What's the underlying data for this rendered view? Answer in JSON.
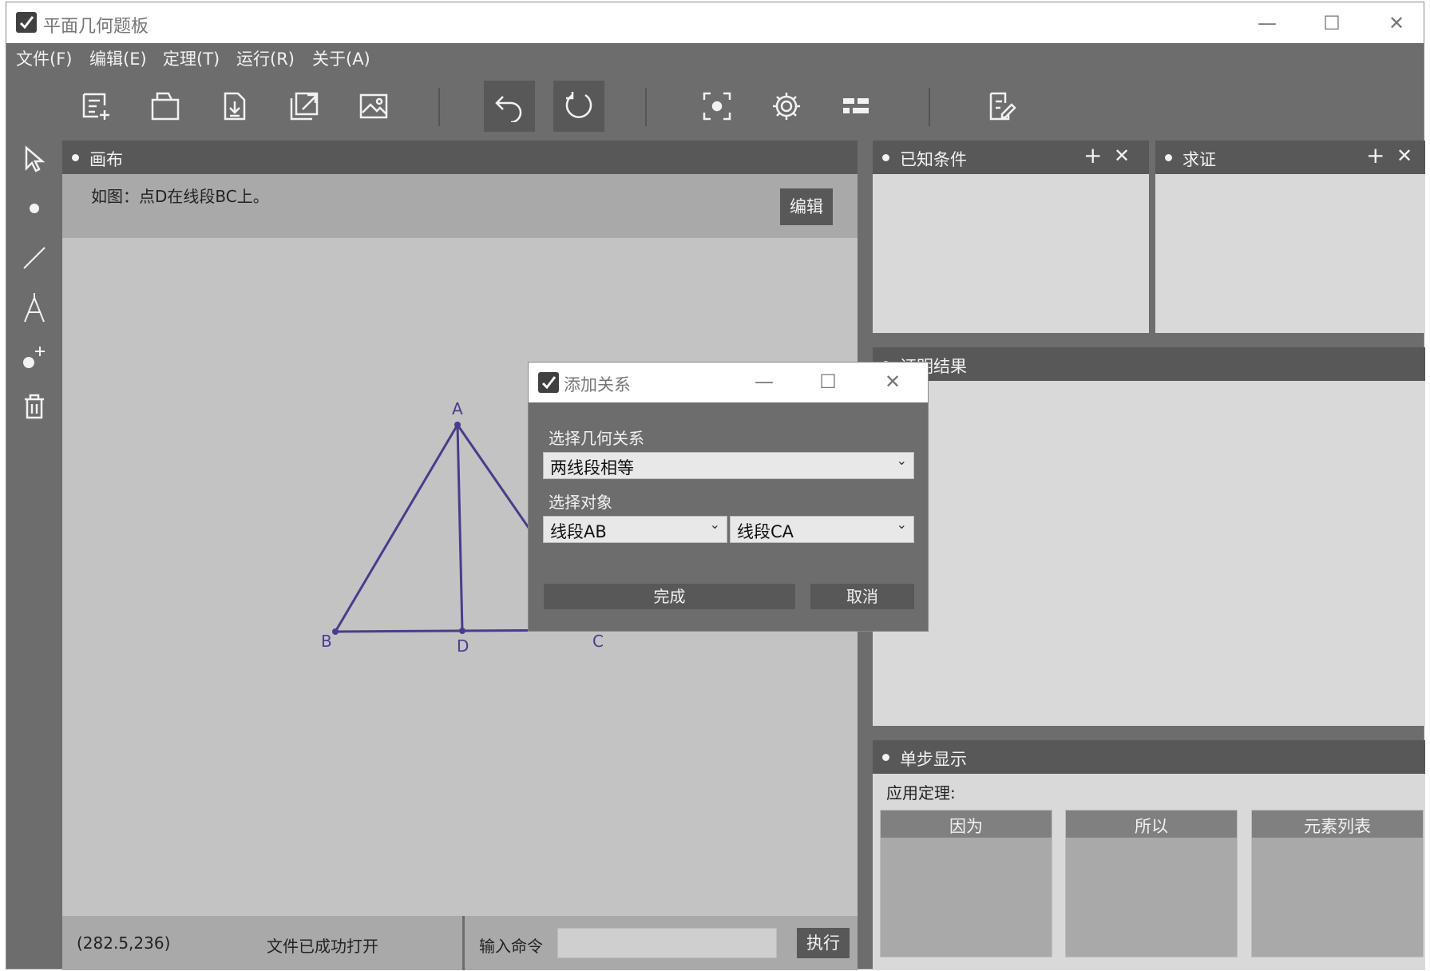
{
  "window": {
    "title": "平面几何题板",
    "minimize_icon": "minimize-icon",
    "maximize_icon": "maximize-icon",
    "close_icon": "close-icon"
  },
  "menu": {
    "items": [
      "文件(F)",
      "编辑(E)",
      "定理(T)",
      "运行(R)",
      "关于(A)"
    ]
  },
  "toolbar": {
    "icons": [
      "new-file-icon",
      "open-file-icon",
      "save-file-icon",
      "export-icon",
      "image-icon",
      "undo-icon",
      "redo-icon",
      "focus-icon",
      "settings-icon",
      "layout-icon",
      "edit-note-icon"
    ]
  },
  "tools": {
    "icons": [
      "select-icon",
      "point-icon",
      "line-icon",
      "compass-icon",
      "add-point-icon",
      "delete-icon"
    ]
  },
  "canvas": {
    "header": "画布",
    "problem_text": "如图：点D在线段BC上。",
    "edit_label": "编辑",
    "points": {
      "A": "A",
      "B": "B",
      "C": "C",
      "D": "D"
    },
    "line_color": "#4a3c8c"
  },
  "status": {
    "coords": "(282.5,236)",
    "message": "文件已成功打开",
    "command_label": "输入命令",
    "command_value": "",
    "exec_label": "执行"
  },
  "panels": {
    "known": {
      "title": "已知条件",
      "add": "+",
      "close": "✕"
    },
    "prove": {
      "title": "求证",
      "add": "+",
      "close": "✕"
    },
    "result": {
      "title": "证明结果"
    },
    "step": {
      "title": "单步显示",
      "theorem_label": "应用定理:",
      "columns": [
        "因为",
        "所以",
        "元素列表"
      ]
    }
  },
  "dialog": {
    "title": "添加关系",
    "relation_label": "选择几何关系",
    "relation_value": "两线段相等",
    "object_label": "选择对象",
    "object1_value": "线段AB",
    "object2_value": "线段CA",
    "ok_label": "完成",
    "cancel_label": "取消"
  }
}
